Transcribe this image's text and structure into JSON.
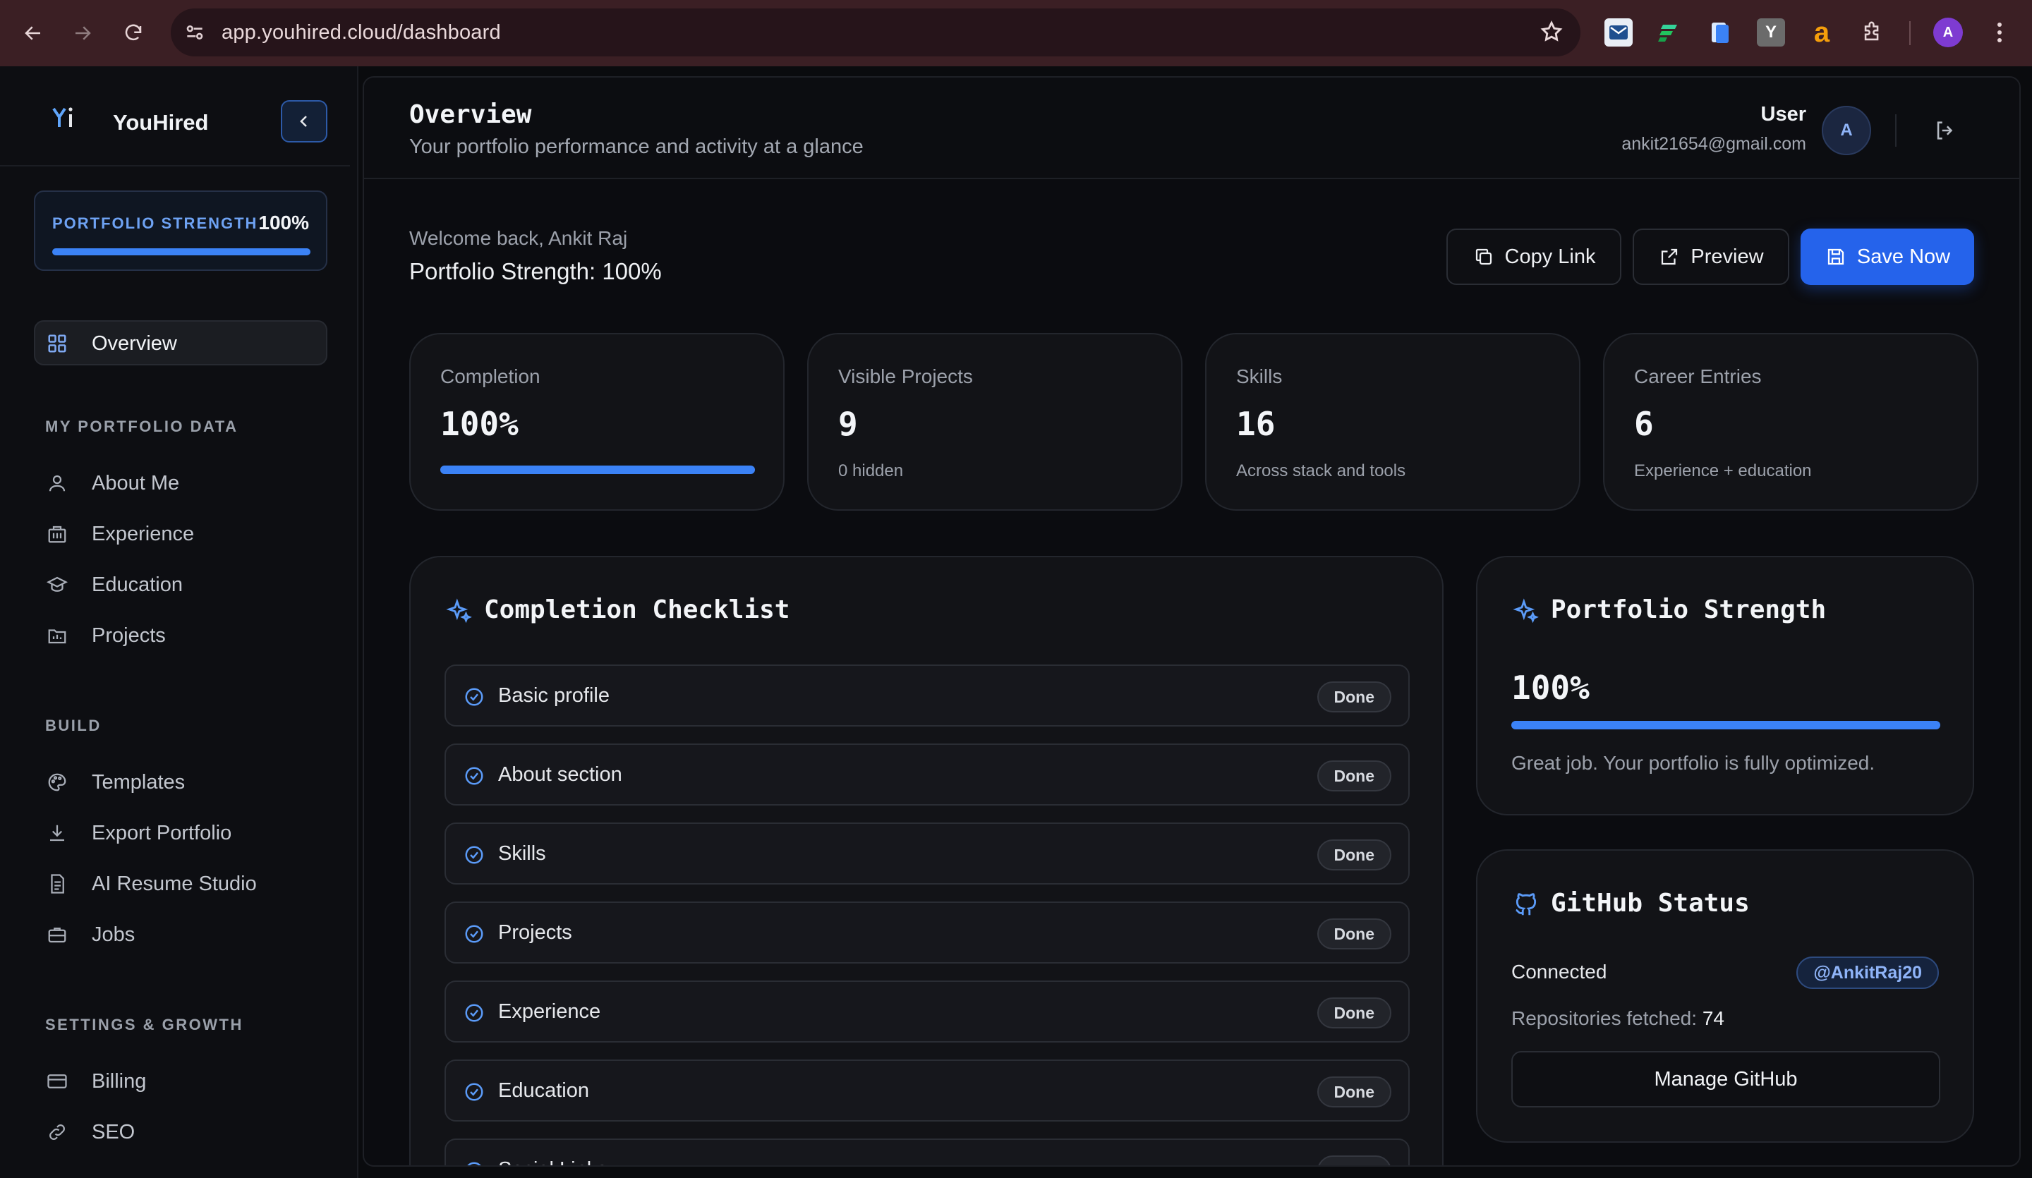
{
  "browser": {
    "url": "app.youhired.cloud/dashboard",
    "profile_initial": "A"
  },
  "brand": {
    "name": "YouHired",
    "logo_text": "Yi"
  },
  "sidebar": {
    "strength_label": "PORTFOLIO STRENGTH",
    "strength_value": "100%",
    "strength_fraction": 1.0,
    "overview_label": "Overview",
    "sections": [
      {
        "title": "MY PORTFOLIO DATA",
        "items": [
          "About Me",
          "Experience",
          "Education",
          "Projects"
        ]
      },
      {
        "title": "BUILD",
        "items": [
          "Templates",
          "Export Portfolio",
          "AI Resume Studio",
          "Jobs"
        ]
      },
      {
        "title": "SETTINGS & GROWTH",
        "items": [
          "Billing",
          "SEO"
        ]
      }
    ]
  },
  "header": {
    "title": "Overview",
    "subtitle": "Your portfolio performance and activity at a glance",
    "user_name": "User",
    "user_email": "ankit21654@gmail.com",
    "avatar_initial": "A"
  },
  "welcome": {
    "greeting": "Welcome back, Ankit Raj",
    "strength_line": "Portfolio Strength: 100%"
  },
  "actions": {
    "copy_link": "Copy Link",
    "preview": "Preview",
    "save_now": "Save Now"
  },
  "stats": [
    {
      "label": "Completion",
      "value": "100%",
      "progress": 1.0
    },
    {
      "label": "Visible Projects",
      "value": "9",
      "sub": "0 hidden"
    },
    {
      "label": "Skills",
      "value": "16",
      "sub": "Across stack and tools"
    },
    {
      "label": "Career Entries",
      "value": "6",
      "sub": "Experience + education"
    }
  ],
  "checklist": {
    "title": "Completion Checklist",
    "items": [
      {
        "label": "Basic profile",
        "status": "Done"
      },
      {
        "label": "About section",
        "status": "Done"
      },
      {
        "label": "Skills",
        "status": "Done"
      },
      {
        "label": "Projects",
        "status": "Done"
      },
      {
        "label": "Experience",
        "status": "Done"
      },
      {
        "label": "Education",
        "status": "Done"
      },
      {
        "label": "Social Links",
        "status": "Done"
      }
    ]
  },
  "portfolio_strength": {
    "title": "Portfolio Strength",
    "value": "100%",
    "progress": 1.0,
    "message": "Great job. Your portfolio is fully optimized."
  },
  "github": {
    "title": "GitHub Status",
    "status": "Connected",
    "username": "@AnkitRaj20",
    "repos_label": "Repositories fetched:",
    "repos_count": "74",
    "manage_label": "Manage GitHub"
  },
  "colors": {
    "accent": "#3b82f6",
    "primary_button": "#2563eb",
    "chrome": "#3b1f24"
  }
}
